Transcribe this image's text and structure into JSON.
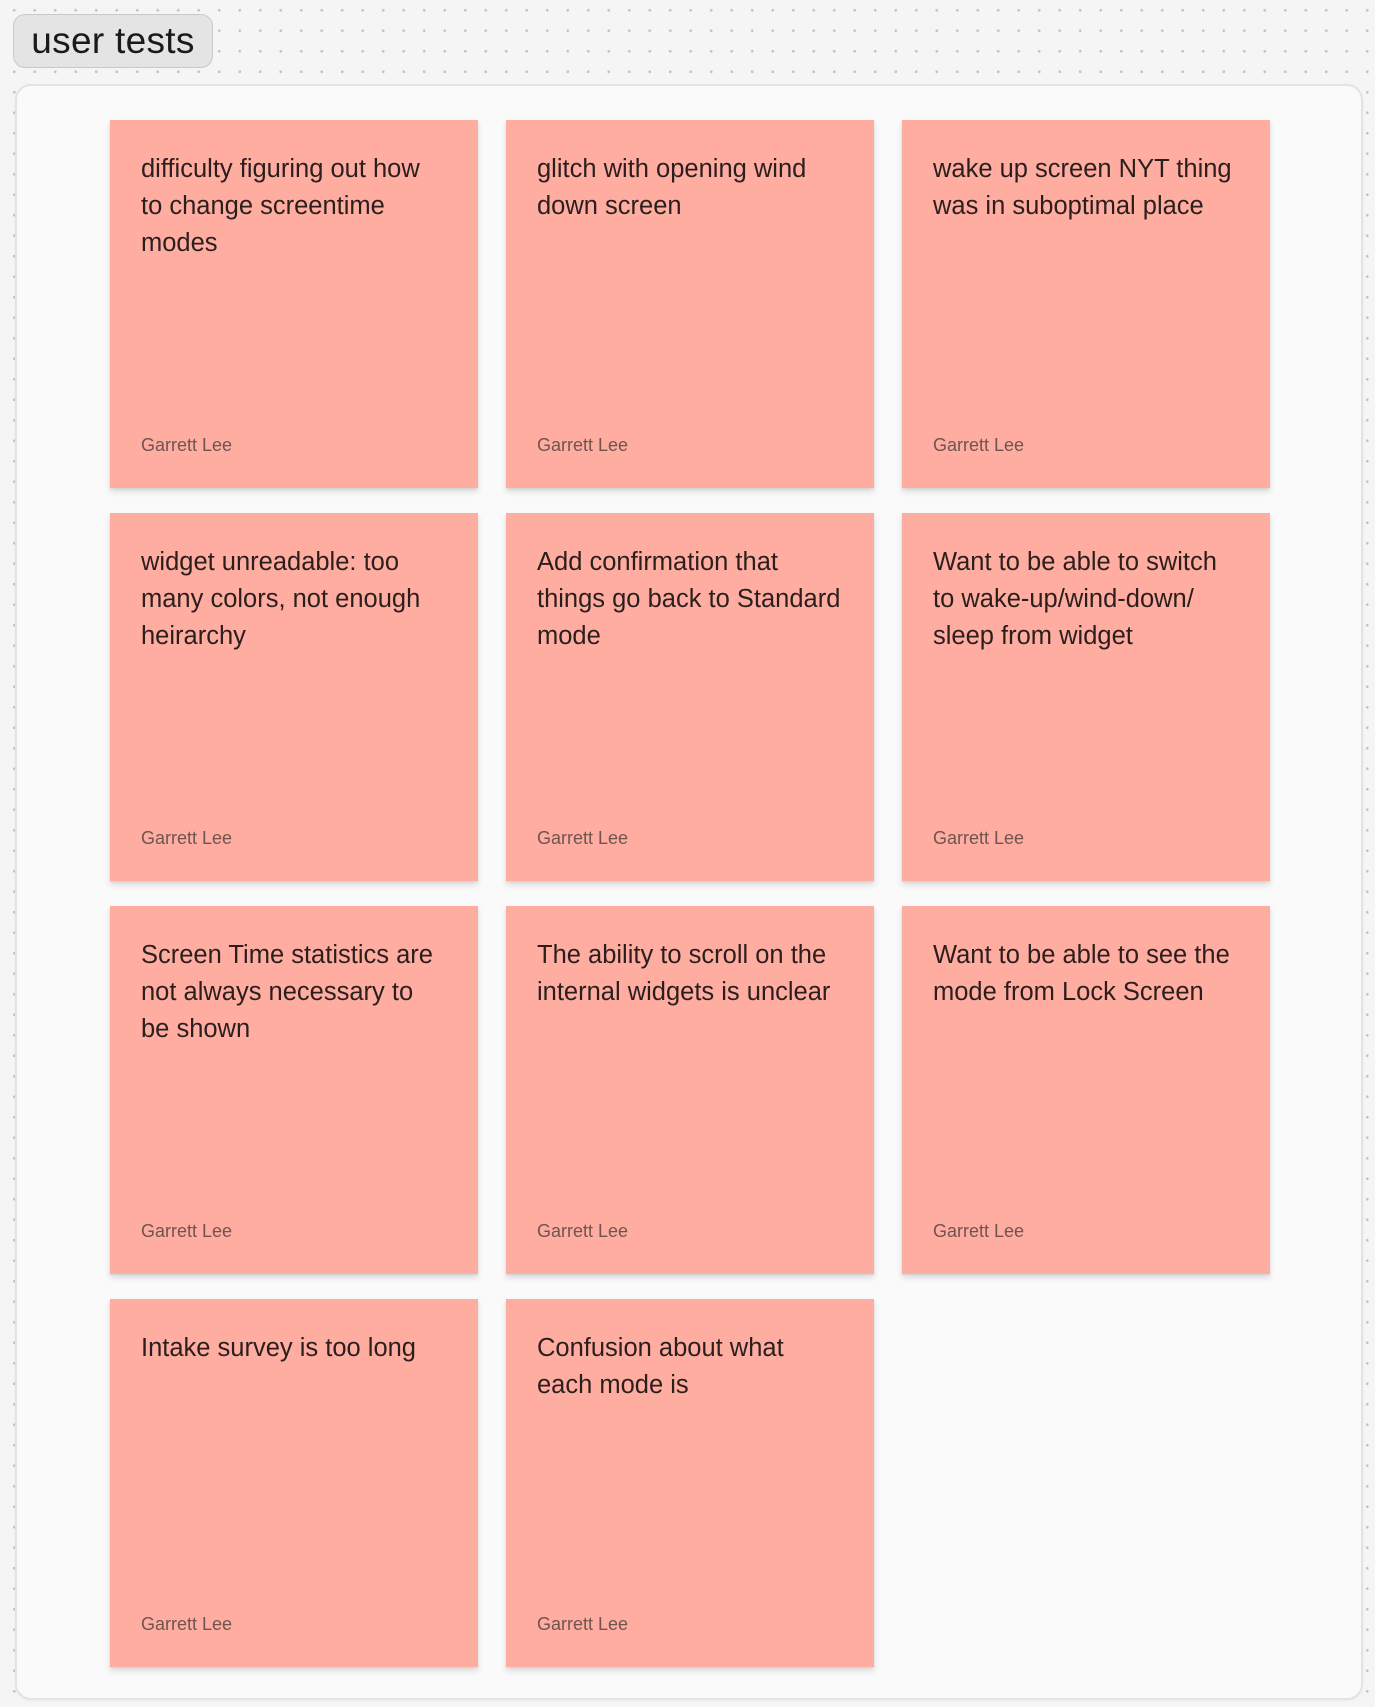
{
  "section": {
    "label": "user tests"
  },
  "stickies": [
    {
      "text": "difficulty figuring out how to change screentime modes",
      "author": "Garrett Lee"
    },
    {
      "text": "glitch with opening wind down screen",
      "author": "Garrett Lee"
    },
    {
      "text": "wake up screen NYT thing was in suboptimal place",
      "author": "Garrett Lee"
    },
    {
      "text": "widget unreadable: too many colors, not enough heirarchy",
      "author": "Garrett Lee"
    },
    {
      "text": "Add confirmation that things go back to Standard mode",
      "author": "Garrett Lee"
    },
    {
      "text": "Want to be able to switch to wake-up/wind-down/ sleep from widget",
      "author": "Garrett Lee"
    },
    {
      "text": "Screen Time statistics are not always necessary to be shown",
      "author": "Garrett Lee"
    },
    {
      "text": "The ability to scroll on the internal widgets is unclear",
      "author": "Garrett Lee"
    },
    {
      "text": "Want to be able to see the mode from Lock Screen",
      "author": "Garrett Lee"
    },
    {
      "text": "Intake survey is too long",
      "author": "Garrett Lee"
    },
    {
      "text": "Confusion about what each mode is",
      "author": "Garrett Lee"
    }
  ],
  "colors": {
    "sticky_fill": "#ffaca1",
    "canvas_background": "#f5f5f5",
    "section_background": "#fafafa"
  }
}
